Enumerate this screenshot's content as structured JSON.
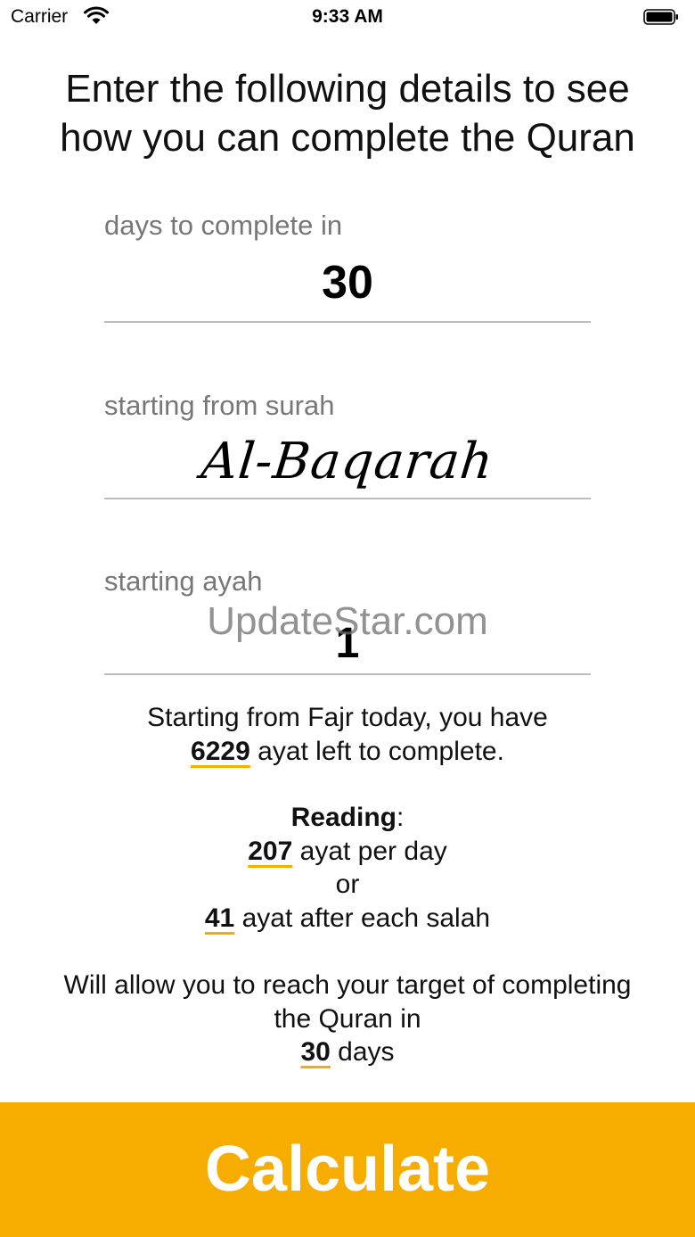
{
  "status_bar": {
    "carrier": "Carrier",
    "time": "9:33 AM"
  },
  "headline": {
    "line1": "Enter the following details to see",
    "line2": "how you can complete the Quran"
  },
  "days_field": {
    "label": "days to complete in",
    "value": "30"
  },
  "surah_field": {
    "label": "starting from surah",
    "value": "Al-Baqarah"
  },
  "ayah_field": {
    "label": "starting ayah",
    "value": "1"
  },
  "watermark": "UpdateStar.com",
  "results": {
    "line1": "Starting from Fajr today, you have",
    "ayat_left": "6229",
    "ayat_left_suffix": " ayat left to complete.",
    "reading_label": "Reading",
    "reading_colon": ":",
    "per_day_value": "207",
    "per_day_suffix": " ayat per day",
    "or": "or",
    "per_salah_value": "41",
    "per_salah_suffix": " ayat after each salah",
    "target_line1": "Will allow you to reach your target of completing",
    "target_line2": "the Quran in",
    "target_days": "30",
    "target_days_suffix": " days"
  },
  "calculate_button": {
    "label": "Calculate"
  },
  "colors": {
    "accent": "#f7ad00",
    "label_gray": "#777777",
    "divider": "#bdbdbd"
  }
}
